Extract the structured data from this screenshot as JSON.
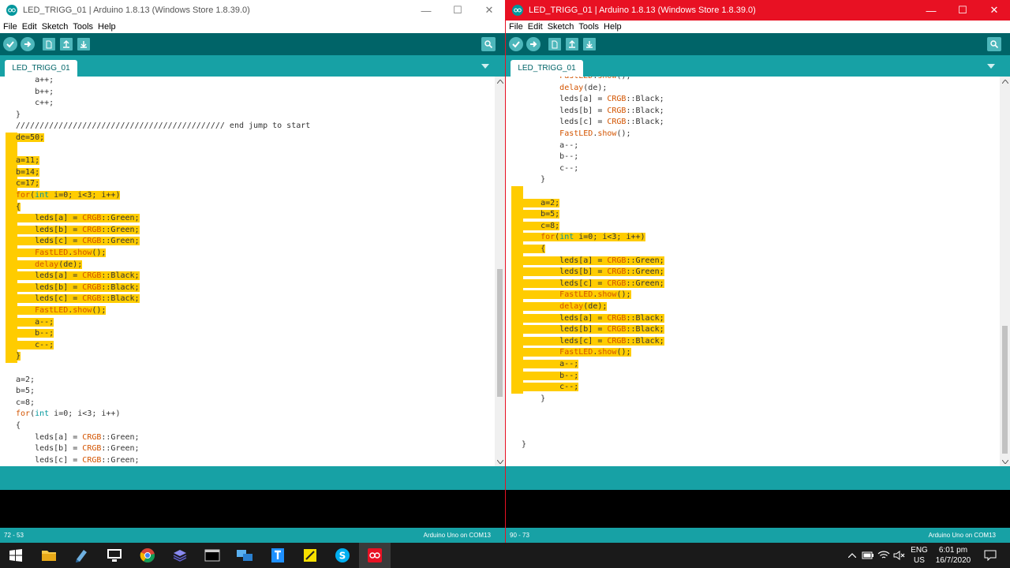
{
  "windows": [
    {
      "id": "left",
      "title": "LED_TRIGG_01 | Arduino 1.8.13 (Windows Store 1.8.39.0)",
      "menu": [
        "File",
        "Edit",
        "Sketch",
        "Tools",
        "Help"
      ],
      "tab_label": "LED_TRIGG_01",
      "cursor_position": "72 - 53",
      "board": "Arduino Uno on COM13",
      "code_lines": [
        "    a++;",
        "    b++;",
        "    c++;",
        "}",
        "//////////////////////////////////////////// end jump to start",
        "de=50;",
        "",
        "a=11;",
        "b=14;",
        "c=17;",
        "for(int i=0; i<3; i++)",
        "{",
        "    leds[a] = CRGB::Green;",
        "    leds[b] = CRGB::Green;",
        "    leds[c] = CRGB::Green;",
        "    FastLED.show();",
        "    delay(de);",
        "    leds[a] = CRGB::Black;",
        "    leds[b] = CRGB::Black;",
        "    leds[c] = CRGB::Black;",
        "    FastLED.show();",
        "    a--;",
        "    b--;",
        "    c--;",
        "}",
        "",
        "a=2;",
        "b=5;",
        "c=8;",
        "for(int i=0; i<3; i++)",
        "{",
        "    leds[a] = CRGB::Green;",
        "    leds[b] = CRGB::Green;",
        "    leds[c] = CRGB::Green;"
      ],
      "scroll_fraction": 0.55
    },
    {
      "id": "right",
      "title": "LED_TRIGG_01 | Arduino 1.8.13 (Windows Store 1.8.39.0)",
      "menu": [
        "File",
        "Edit",
        "Sketch",
        "Tools",
        "Help"
      ],
      "tab_label": "LED_TRIGG_01",
      "cursor_position": "90 - 73",
      "board": "Arduino Uno on COM13",
      "code_lines": [
        "        FastLED.show();",
        "        delay(de);",
        "        leds[a] = CRGB::Black;",
        "        leds[b] = CRGB::Black;",
        "        leds[c] = CRGB::Black;",
        "        FastLED.show();",
        "        a--;",
        "        b--;",
        "        c--;",
        "    }",
        "",
        "    a=2;",
        "    b=5;",
        "    c=8;",
        "    for(int i=0; i<3; i++)",
        "    {",
        "        leds[a] = CRGB::Green;",
        "        leds[b] = CRGB::Green;",
        "        leds[c] = CRGB::Green;",
        "        FastLED.show();",
        "        delay(de);",
        "        leds[a] = CRGB::Black;",
        "        leds[b] = CRGB::Black;",
        "        leds[c] = CRGB::Black;",
        "        FastLED.show();",
        "        a--;",
        "        b--;",
        "        c--;",
        "    }",
        "",
        "",
        "",
        "}"
      ],
      "scroll_fraction": 1.0
    }
  ],
  "taskbar": {
    "apps": [
      "start-icon",
      "file-explorer-icon",
      "notepad-icon",
      "remote-desktop-icon",
      "chrome-icon",
      "stack-icon",
      "terminal-icon",
      "network-icon",
      "text-editor-icon",
      "sticky-notes-icon",
      "skype-icon",
      "arduino-icon"
    ],
    "lang_top": "ENG",
    "lang_bottom": "US",
    "time": "6:01 pm",
    "date": "16/7/2020"
  },
  "colors": {
    "teal_dark": "#006468",
    "teal": "#17a1a5",
    "highlight": "#ffcc00",
    "keyword": "#d35400",
    "type": "#00979c",
    "active_title": "#e81123"
  }
}
